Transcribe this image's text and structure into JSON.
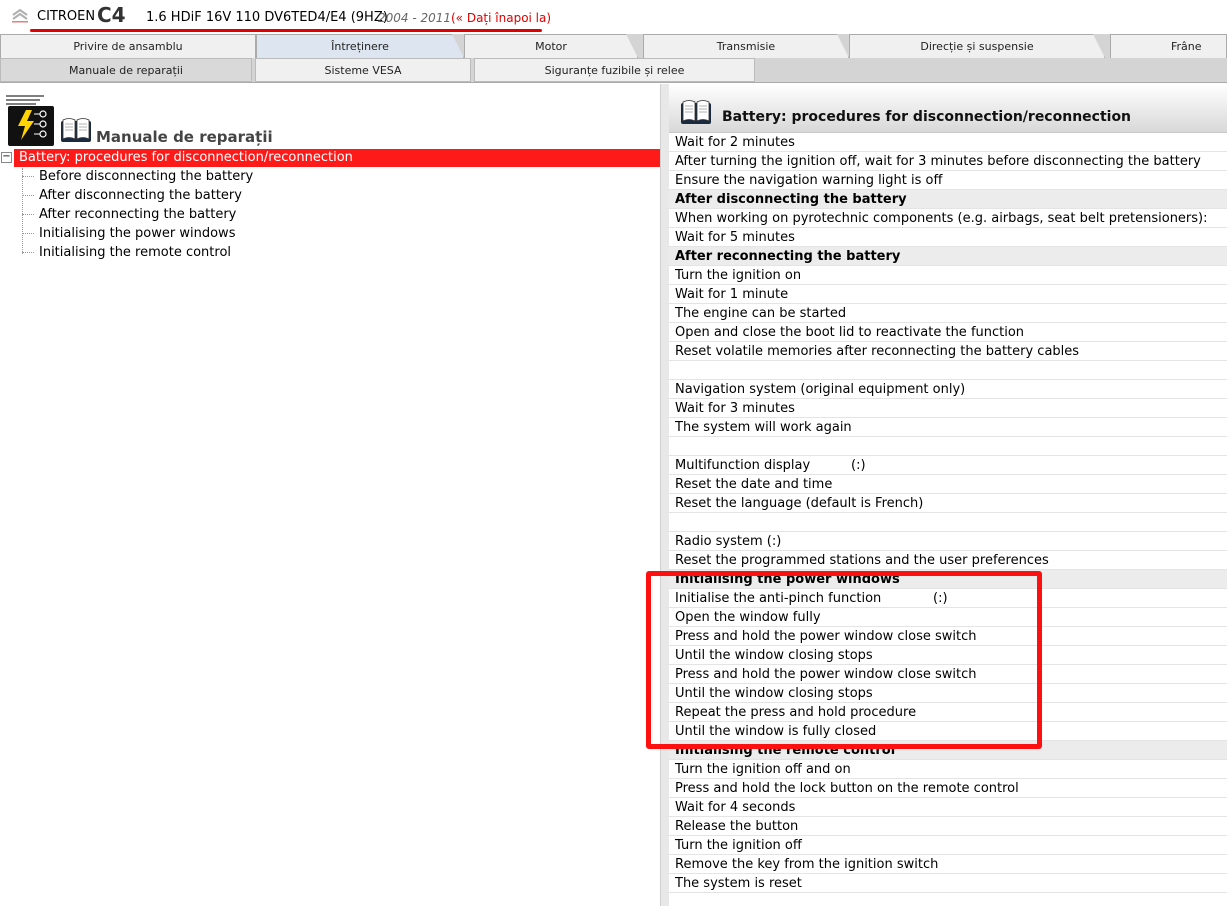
{
  "header": {
    "brand": "CITROEN",
    "model": "C4",
    "engine": "1.6 HDiF 16V 110 DV6TED4/E4 (9HZ)",
    "years": "2004 - 2011",
    "back_link": "(« Dați înapoi la)"
  },
  "tabs": [
    {
      "label": "Privire de ansamblu"
    },
    {
      "label": "Întreținere"
    },
    {
      "label": "Motor"
    },
    {
      "label": "Transmisie"
    },
    {
      "label": "Direcție și suspensie"
    },
    {
      "label": "Frâne"
    }
  ],
  "subtabs": [
    {
      "label": "Manuale de reparații"
    },
    {
      "label": "Sisteme VESA"
    },
    {
      "label": "Siguranțe fuzibile și relee"
    }
  ],
  "left_pane": {
    "title": "Manuale de reparații",
    "tree_root": "Battery: procedures for disconnection/reconnection",
    "tree_items": [
      "Before disconnecting the battery",
      "After disconnecting the battery",
      "After reconnecting the battery",
      "Initialising the power windows",
      "Initialising the remote control"
    ]
  },
  "content": {
    "title": "Battery: procedures for disconnection/reconnection",
    "rows": [
      {
        "text": "Wait for 2 minutes",
        "section": false
      },
      {
        "text": "After turning the ignition off, wait for 3 minutes before disconnecting the battery",
        "section": false
      },
      {
        "text": "Ensure the navigation warning light is off",
        "section": false
      },
      {
        "text": "After disconnecting the battery",
        "section": true
      },
      {
        "text": "When working on pyrotechnic components (e.g. airbags, seat belt pretensioners):",
        "section": false
      },
      {
        "text": "Wait for 5 minutes",
        "section": false
      },
      {
        "text": "After reconnecting the battery",
        "section": true
      },
      {
        "text": "Turn the ignition on",
        "section": false
      },
      {
        "text": "Wait for 1 minute",
        "section": false
      },
      {
        "text": "The engine can be started",
        "section": false
      },
      {
        "text": "Open and close the boot lid to reactivate the function",
        "section": false
      },
      {
        "text": "Reset volatile memories after reconnecting the battery cables",
        "section": false
      },
      {
        "text": "",
        "section": false
      },
      {
        "text": "Navigation system (original equipment only)",
        "section": false
      },
      {
        "text": "Wait for 3 minutes",
        "section": false
      },
      {
        "text": "The system will work again",
        "section": false
      },
      {
        "text": "",
        "section": false
      },
      {
        "text": "Multifunction display",
        "suffix": "(:)",
        "section": false
      },
      {
        "text": "Reset the date and time",
        "section": false
      },
      {
        "text": "Reset the language (default is French)",
        "section": false
      },
      {
        "text": "",
        "section": false
      },
      {
        "text": "Radio system (:)",
        "section": false
      },
      {
        "text": "Reset the programmed stations and the user preferences",
        "section": false
      },
      {
        "text": "Initialising the power windows",
        "section": true
      },
      {
        "text": "Initialise the anti-pinch function",
        "suffix": "(:)",
        "section": false
      },
      {
        "text": "Open the window fully",
        "section": false
      },
      {
        "text": "Press and hold the power window close switch",
        "section": false
      },
      {
        "text": "Until the window closing stops",
        "section": false
      },
      {
        "text": "Press and hold the power window close switch",
        "section": false
      },
      {
        "text": "Until the window closing stops",
        "section": false
      },
      {
        "text": "Repeat the press and hold procedure",
        "section": false
      },
      {
        "text": "Until the window is fully closed",
        "section": false
      },
      {
        "text": "Initialising the remote control",
        "section": true
      },
      {
        "text": "Turn the ignition off and on",
        "section": false
      },
      {
        "text": "Press and hold the lock button on the remote control",
        "section": false
      },
      {
        "text": "Wait for 4 seconds",
        "section": false
      },
      {
        "text": "Release the button",
        "section": false
      },
      {
        "text": "Turn the ignition off",
        "section": false
      },
      {
        "text": "Remove the key from the ignition switch",
        "section": false
      },
      {
        "text": "The system is reset",
        "section": false
      }
    ]
  },
  "colors": {
    "accent_red": "#ff1a1a",
    "highlight": "#ff1010"
  }
}
